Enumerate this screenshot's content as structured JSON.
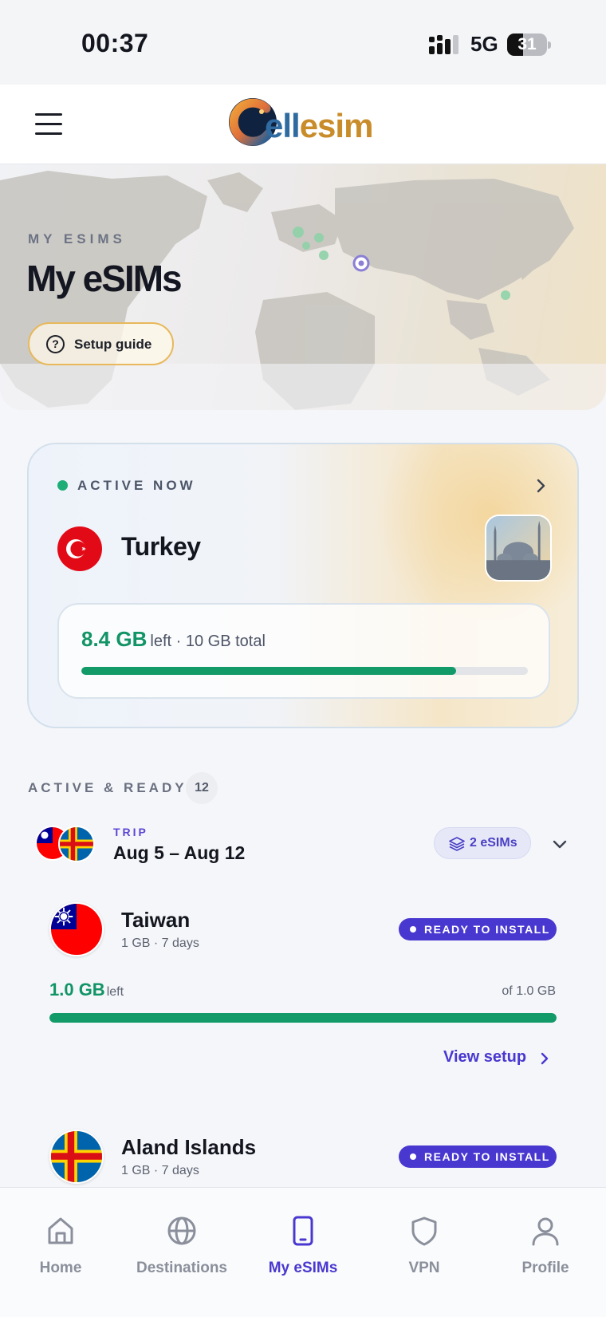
{
  "status_bar": {
    "time": "00:37",
    "network": "5G",
    "battery": "31"
  },
  "header": {
    "logo": {
      "text_a": "ell",
      "text_b": "esim",
      "alt": "Cellesim"
    },
    "icons": {
      "menu": "hamburger-menu-icon"
    }
  },
  "hero": {
    "eyebrow": "MY ESIMS",
    "title": "My eSIMs",
    "setup_button": "Setup guide"
  },
  "active_card": {
    "status": "ACTIVE NOW",
    "country": "Turkey",
    "data_left": "8.4 GB",
    "data_rest": "left · 10 GB total",
    "progress": 0.84
  },
  "section": {
    "title": "ACTIVE & READY",
    "count": "12"
  },
  "trip": {
    "eyebrow": "TRIP",
    "dates": "Aug 5 – Aug 12",
    "badge": "2 eSIMs"
  },
  "esims": [
    {
      "name": "Taiwan",
      "plan": "1 GB · 7 days",
      "status": "READY TO INSTALL",
      "left": "1.0 GB",
      "left_suffix": "left",
      "of_total": "of 1.0 GB",
      "progress": 1.0,
      "action": "View setup"
    },
    {
      "name": "Aland Islands",
      "plan": "1 GB · 7 days",
      "status": "READY TO INSTALL"
    }
  ],
  "nav": [
    {
      "label": "Home",
      "icon": "home-icon"
    },
    {
      "label": "Destinations",
      "icon": "globe-icon"
    },
    {
      "label": "My eSIMs",
      "icon": "phone-icon",
      "active": true
    },
    {
      "label": "VPN",
      "icon": "shield-icon"
    },
    {
      "label": "Profile",
      "icon": "user-icon"
    }
  ],
  "colors": {
    "accent": "#4938d0",
    "success": "#139a69",
    "setup_border": "#e8b85a",
    "nav_inactive": "#8a8f9b"
  }
}
